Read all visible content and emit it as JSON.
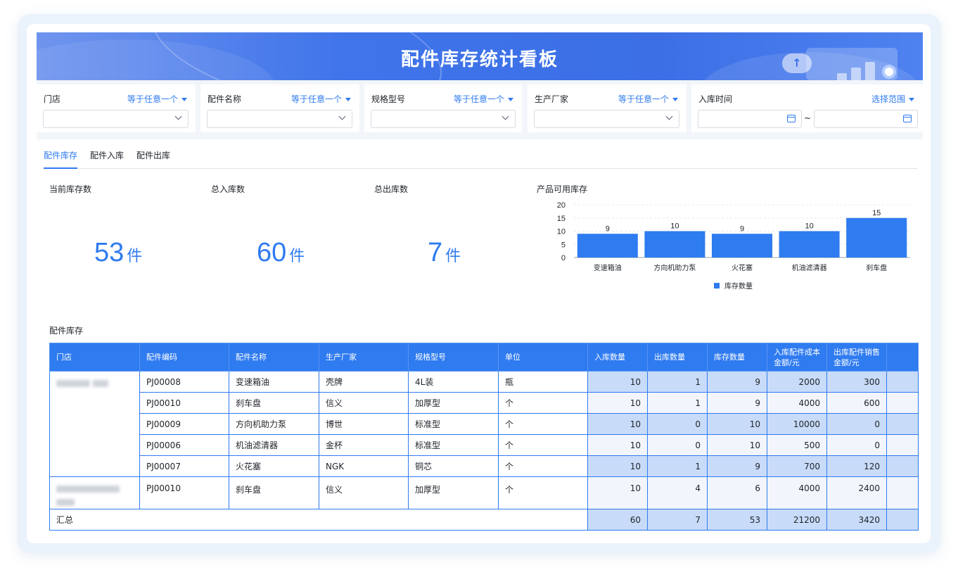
{
  "header": {
    "title": "配件库存统计看板"
  },
  "filters": [
    {
      "label": "门店",
      "operator": "等于任意一个"
    },
    {
      "label": "配件名称",
      "operator": "等于任意一个"
    },
    {
      "label": "规格型号",
      "operator": "等于任意一个"
    },
    {
      "label": "生产厂家",
      "operator": "等于任意一个"
    },
    {
      "label": "入库时间",
      "operator": "选择范围",
      "separator": "~"
    }
  ],
  "tabs": [
    "配件库存",
    "配件入库",
    "配件出库"
  ],
  "active_tab": "配件库存",
  "kpis": [
    {
      "title": "当前库存数",
      "value": "53",
      "unit": "件"
    },
    {
      "title": "总入库数",
      "value": "60",
      "unit": "件"
    },
    {
      "title": "总出库数",
      "value": "7",
      "unit": "件"
    }
  ],
  "chart_title": "产品可用库存",
  "chart_data": {
    "type": "bar",
    "title": "产品可用库存",
    "categories": [
      "变速箱油",
      "方向机助力泵",
      "火花塞",
      "机油滤清器",
      "刹车盘"
    ],
    "series": [
      {
        "name": "库存数量",
        "values": [
          9,
          10,
          9,
          10,
          15
        ]
      }
    ],
    "ylim": [
      0,
      20
    ],
    "yticks": [
      0,
      5,
      10,
      15,
      20
    ],
    "legend": "bottom",
    "color": "#2f7bf0"
  },
  "table": {
    "title": "配件库存",
    "columns": [
      "门店",
      "配件编码",
      "配件名称",
      "生产厂家",
      "规格型号",
      "单位",
      "入库数量",
      "出库数量",
      "库存数量",
      "入库配件成本金额/元",
      "出库配件销售金额/元",
      ""
    ],
    "rows": [
      [
        "PJ00008",
        "变速箱油",
        "壳牌",
        "4L装",
        "瓶",
        "10",
        "1",
        "9",
        "2000",
        "300"
      ],
      [
        "PJ00010",
        "刹车盘",
        "信义",
        "加厚型",
        "个",
        "10",
        "1",
        "9",
        "4000",
        "600"
      ],
      [
        "PJ00009",
        "方向机助力泵",
        "博世",
        "标准型",
        "个",
        "10",
        "0",
        "10",
        "10000",
        "0"
      ],
      [
        "PJ00006",
        "机油滤清器",
        "金杯",
        "标准型",
        "个",
        "10",
        "0",
        "10",
        "500",
        "0"
      ],
      [
        "PJ00007",
        "火花塞",
        "NGK",
        "铜芯",
        "个",
        "10",
        "1",
        "9",
        "700",
        "120"
      ],
      [
        "PJ00010",
        "刹车盘",
        "信义",
        "加厚型",
        "个",
        "10",
        "4",
        "6",
        "4000",
        "2400"
      ]
    ],
    "total": {
      "label": "汇总",
      "values": [
        "60",
        "7",
        "53",
        "21200",
        "3420"
      ]
    }
  }
}
